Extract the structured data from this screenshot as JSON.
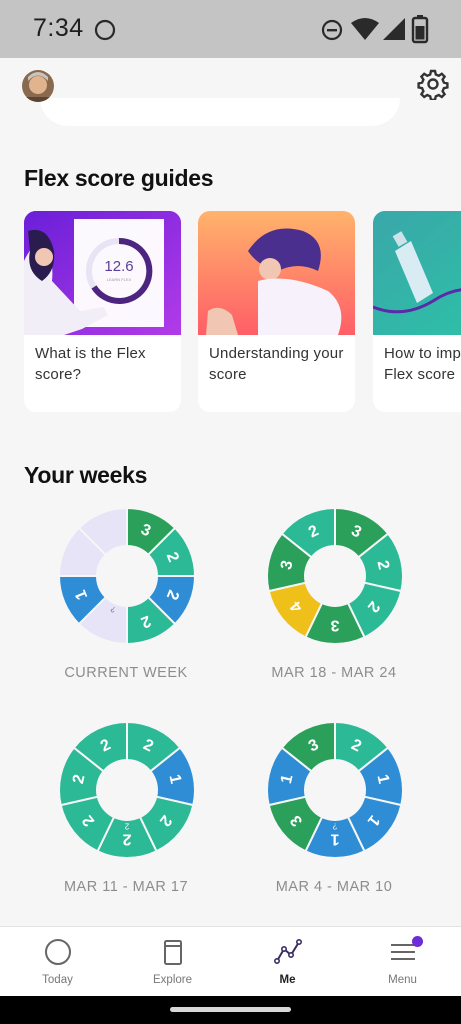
{
  "status_bar": {
    "time": "7:34",
    "icons": [
      "circle-notification-icon",
      "do-not-disturb-icon",
      "wifi-icon",
      "signal-icon",
      "battery-icon"
    ]
  },
  "header": {
    "avatar": "user-avatar",
    "settings_icon": "gear-icon"
  },
  "guides": {
    "title": "Flex score guides",
    "cards": [
      {
        "label": "What is the Flex score?",
        "illustration": "flex-score-chart",
        "score_value": "12.6",
        "score_caption": "LEARN FLEX"
      },
      {
        "label": "Understanding your score",
        "illustration": "woman-stretching"
      },
      {
        "label": "How to improve your Flex score",
        "illustration": "water-bottle"
      }
    ]
  },
  "weeks": {
    "title": "Your weeks",
    "items": [
      {
        "label": "CURRENT WEEK",
        "days": [
          {
            "value": 3,
            "status": "green"
          },
          {
            "value": 2,
            "status": "teal"
          },
          {
            "value": 2,
            "status": "blue"
          },
          {
            "value": 2,
            "status": "teal"
          },
          {
            "value": "",
            "status": "partial",
            "note": "?"
          },
          {
            "value": 1,
            "status": "blue"
          },
          {
            "value": "",
            "status": "empty"
          },
          {
            "value": "",
            "status": "empty"
          }
        ]
      },
      {
        "label": "MAR 18 - MAR 24",
        "days": [
          {
            "value": 3,
            "status": "green"
          },
          {
            "value": 2,
            "status": "teal"
          },
          {
            "value": 2,
            "status": "teal"
          },
          {
            "value": 3,
            "status": "green"
          },
          {
            "value": 4,
            "status": "yellow"
          },
          {
            "value": 3,
            "status": "green"
          },
          {
            "value": 2,
            "status": "teal"
          }
        ]
      },
      {
        "label": "MAR 11 - MAR 17",
        "days": [
          {
            "value": 2,
            "status": "teal"
          },
          {
            "value": 1,
            "status": "blue"
          },
          {
            "value": 2,
            "status": "teal"
          },
          {
            "value": 2,
            "status": "teal",
            "note": "2"
          },
          {
            "value": 2,
            "status": "teal"
          },
          {
            "value": 2,
            "status": "teal"
          },
          {
            "value": 2,
            "status": "teal"
          }
        ]
      },
      {
        "label": "MAR 4 - MAR 10",
        "days": [
          {
            "value": 2,
            "status": "teal"
          },
          {
            "value": 1,
            "status": "blue"
          },
          {
            "value": 1,
            "status": "blue"
          },
          {
            "value": 1,
            "status": "blue",
            "note": "?"
          },
          {
            "value": 3,
            "status": "green"
          },
          {
            "value": 1,
            "status": "blue"
          },
          {
            "value": 3,
            "status": "green"
          }
        ]
      }
    ]
  },
  "colors": {
    "green": "#2aa05a",
    "teal": "#2bb996",
    "blue": "#2f8dd6",
    "yellow": "#f0c01a",
    "empty": "#e6e4f6",
    "partial": "#e6e4f6",
    "accent": "#6d2bd9",
    "nav_active": "#3b2c63"
  },
  "nav": {
    "items": [
      {
        "label": "Today",
        "icon": "circle-icon",
        "active": false
      },
      {
        "label": "Explore",
        "icon": "cards-icon",
        "active": false
      },
      {
        "label": "Me",
        "icon": "line-chart-icon",
        "active": true
      },
      {
        "label": "Menu",
        "icon": "hamburger-menu-icon",
        "active": false,
        "badge": true
      }
    ]
  }
}
